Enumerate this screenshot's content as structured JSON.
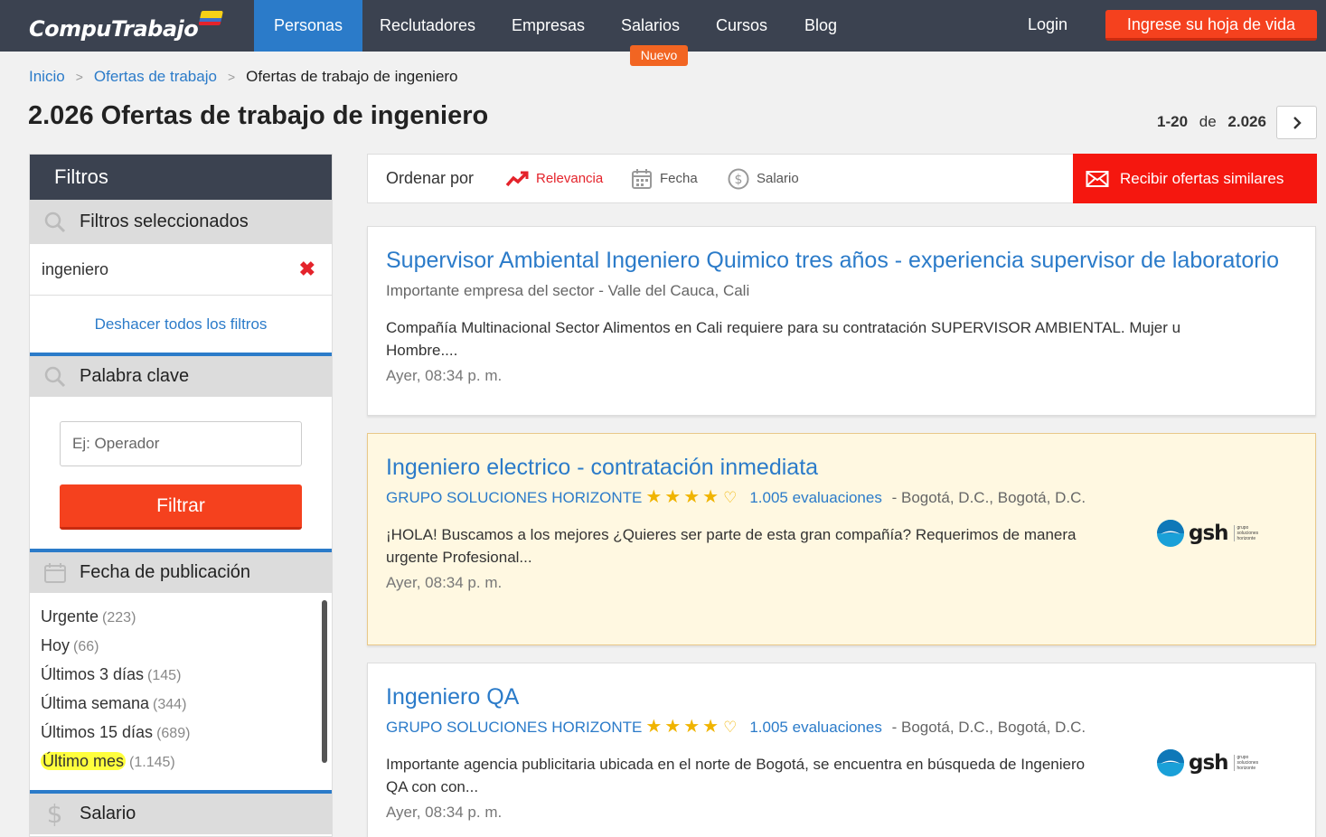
{
  "brand": {
    "name": "CompuTrabajo"
  },
  "nav": {
    "items": [
      "Personas",
      "Reclutadores",
      "Empresas",
      "Salarios",
      "Cursos",
      "Blog"
    ],
    "badge": "Nuevo",
    "login": "Login",
    "cta": "Ingrese su hoja de vida"
  },
  "breadcrumb": {
    "home": "Inicio",
    "level1": "Ofertas de trabajo",
    "current": "Ofertas de trabajo de ingeniero",
    "separator": ">"
  },
  "header": {
    "count": "2.026",
    "title": "Ofertas de trabajo de ingeniero"
  },
  "pager": {
    "range": "1-20",
    "of": "de",
    "total": "2.026"
  },
  "sidebar": {
    "title": "Filtros",
    "selected_title": "Filtros seleccionados",
    "selected_value": "ingeniero",
    "remove_symbol": "✖",
    "undo_all": "Deshacer todos los filtros",
    "keyword_title": "Palabra clave",
    "keyword_placeholder": "Ej: Operador",
    "filter_button": "Filtrar",
    "date_title": "Fecha de publicación",
    "date_options": [
      {
        "label": "Urgente",
        "count": "(223)"
      },
      {
        "label": "Hoy",
        "count": "(66)"
      },
      {
        "label": "Últimos 3 días",
        "count": "(145)"
      },
      {
        "label": "Última semana",
        "count": "(344)"
      },
      {
        "label": "Últimos 15 días",
        "count": "(689)"
      },
      {
        "label": "Último mes",
        "count": "(1.145)",
        "highlighted": true
      }
    ],
    "salary_title": "Salario"
  },
  "order": {
    "label": "Ordenar por",
    "options": [
      "Relevancia",
      "Fecha",
      "Salario"
    ],
    "active": "Relevancia",
    "receive_button": "Recibir ofertas similares"
  },
  "jobs": [
    {
      "title": "Supervisor Ambiental Ingeniero Quimico tres años - experiencia supervisor de laboratorio",
      "company": "Importante empresa del sector",
      "location": "- Valle del Cauca, Cali",
      "description": "Compañía Multinacional Sector Alimentos en Cali requiere para su contratación SUPERVISOR AMBIENTAL. Mujer u Hombre....",
      "date": "Ayer, 08:34 p. m."
    },
    {
      "title": "Ingeniero electrico - contratación inmediata",
      "company": "GRUPO SOLUCIONES HORIZONTE",
      "rating": 4,
      "evaluations": "1.005 evaluaciones",
      "location": "- Bogotá, D.C., Bogotá, D.C.",
      "description": "¡HOLA! Buscamos a los mejores ¿Quieres ser parte de esta gran compañía? Requerimos de manera urgente Profesional...",
      "date": "Ayer, 08:34 p. m.",
      "logo_text": "gsh",
      "logo_sub": "grupo soluciones horizonte",
      "highlighted": true
    },
    {
      "title": "Ingeniero QA",
      "company": "GRUPO SOLUCIONES HORIZONTE",
      "rating": 4,
      "evaluations": "1.005 evaluaciones",
      "location": "- Bogotá, D.C., Bogotá, D.C.",
      "description": "Importante agencia publicitaria ubicada en el norte de Bogotá, se encuentra en búsqueda de Ingeniero QA con con...",
      "date": "Ayer, 08:34 p. m.",
      "logo_text": "gsh",
      "logo_sub": "grupo soluciones horizonte"
    }
  ],
  "icons": {
    "search": "search-icon",
    "calendar": "calendar-icon",
    "dollar": "dollar-icon",
    "trend": "trend-icon",
    "mail": "mail-icon",
    "chevron": "chevron-right-icon"
  },
  "colors": {
    "navbar": "#3b4250",
    "accent_blue": "#2b7bc9",
    "cta_orange": "#f5411e",
    "highlight": "#ffff3d",
    "nuevo": "#f26522"
  }
}
